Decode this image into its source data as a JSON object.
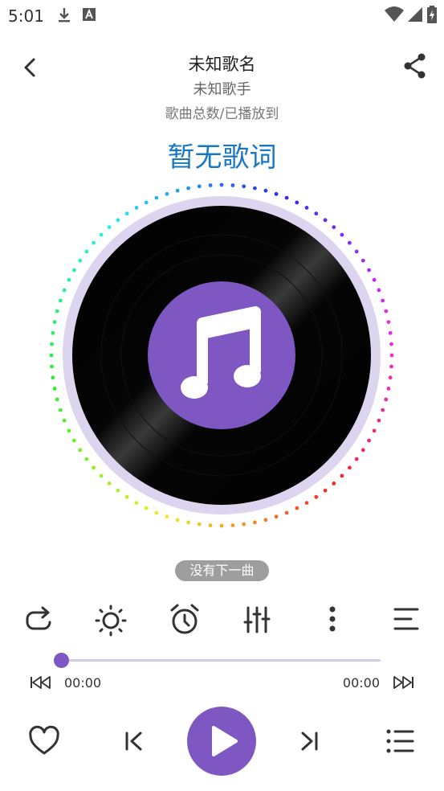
{
  "status_bar": {
    "time": "5:01",
    "icons_left": [
      "download-icon",
      "a-badge-icon"
    ],
    "icons_right": [
      "wifi-icon",
      "signal-icon",
      "battery-icon"
    ]
  },
  "header": {
    "title": "未知歌名",
    "artist": "未知歌手",
    "song_count": "歌曲总数/已播放到",
    "back_icon": "back-arrow-icon",
    "share_icon": "share-icon"
  },
  "lyrics": "暂无歌词",
  "disc": {
    "center_icon": "music-note-icon",
    "accent": "#7e57c2"
  },
  "toast": "没有下一曲",
  "actions": [
    {
      "name": "repeat-button",
      "icon": "repeat-icon"
    },
    {
      "name": "brightness-button",
      "icon": "sun-icon"
    },
    {
      "name": "alarm-button",
      "icon": "alarm-clock-icon"
    },
    {
      "name": "equalizer-button",
      "icon": "equalizer-icon"
    },
    {
      "name": "more-button",
      "icon": "more-vertical-icon"
    },
    {
      "name": "lyrics-align-button",
      "icon": "align-lines-icon"
    }
  ],
  "progress": {
    "fraction": 0,
    "current_time": "00:00",
    "total_time": "00:00"
  },
  "controls": {
    "favorite_icon": "heart-icon",
    "prev_icon": "skip-previous-icon",
    "play_icon": "play-icon",
    "next_icon": "skip-next-icon",
    "playlist_icon": "playlist-icon"
  },
  "colors": {
    "accent": "#7e57c2",
    "lyrics": "#1a78c2",
    "track": "#d6cce9",
    "disc_ring": "#ddd5ef"
  }
}
